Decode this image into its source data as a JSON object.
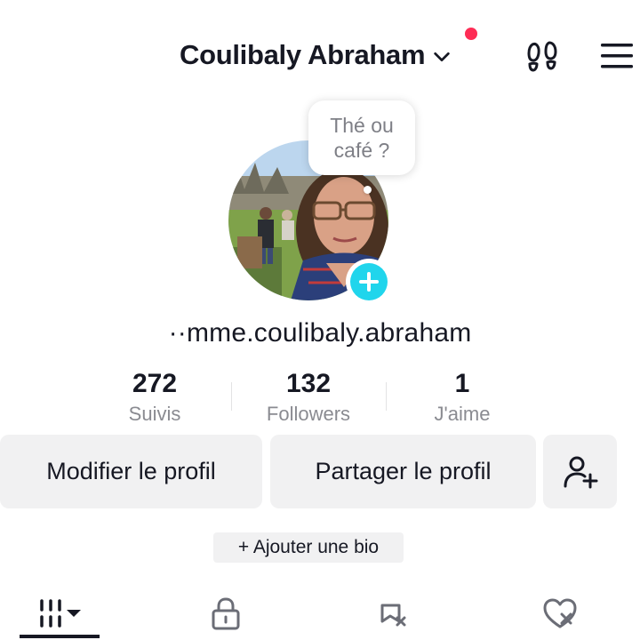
{
  "header": {
    "account_name": "Coulibaly Abraham",
    "has_notification": true,
    "accent_color": "#fe2c55",
    "icons": [
      "chevron-down-icon",
      "footprint-icon",
      "menu-icon"
    ]
  },
  "profile": {
    "thought_line1": "Thé ou",
    "thought_line2": "café ?",
    "username": "··mme.coulibaly.abraham",
    "add_color": "#20d5ec"
  },
  "stats": [
    {
      "value": "272",
      "label": "Suivis"
    },
    {
      "value": "132",
      "label": "Followers"
    },
    {
      "value": "1",
      "label": "J'aime"
    }
  ],
  "actions": {
    "edit_label": "Modifier le profil",
    "share_label": "Partager le profil",
    "add_friend_icon": "add-person-icon"
  },
  "bio": {
    "add_label": "+ Ajouter une bio"
  },
  "tabs": [
    {
      "icon": "grid-icon",
      "active": true
    },
    {
      "icon": "lock-icon",
      "active": false
    },
    {
      "icon": "bookmark-icon",
      "active": false
    },
    {
      "icon": "liked-icon",
      "active": false
    }
  ]
}
